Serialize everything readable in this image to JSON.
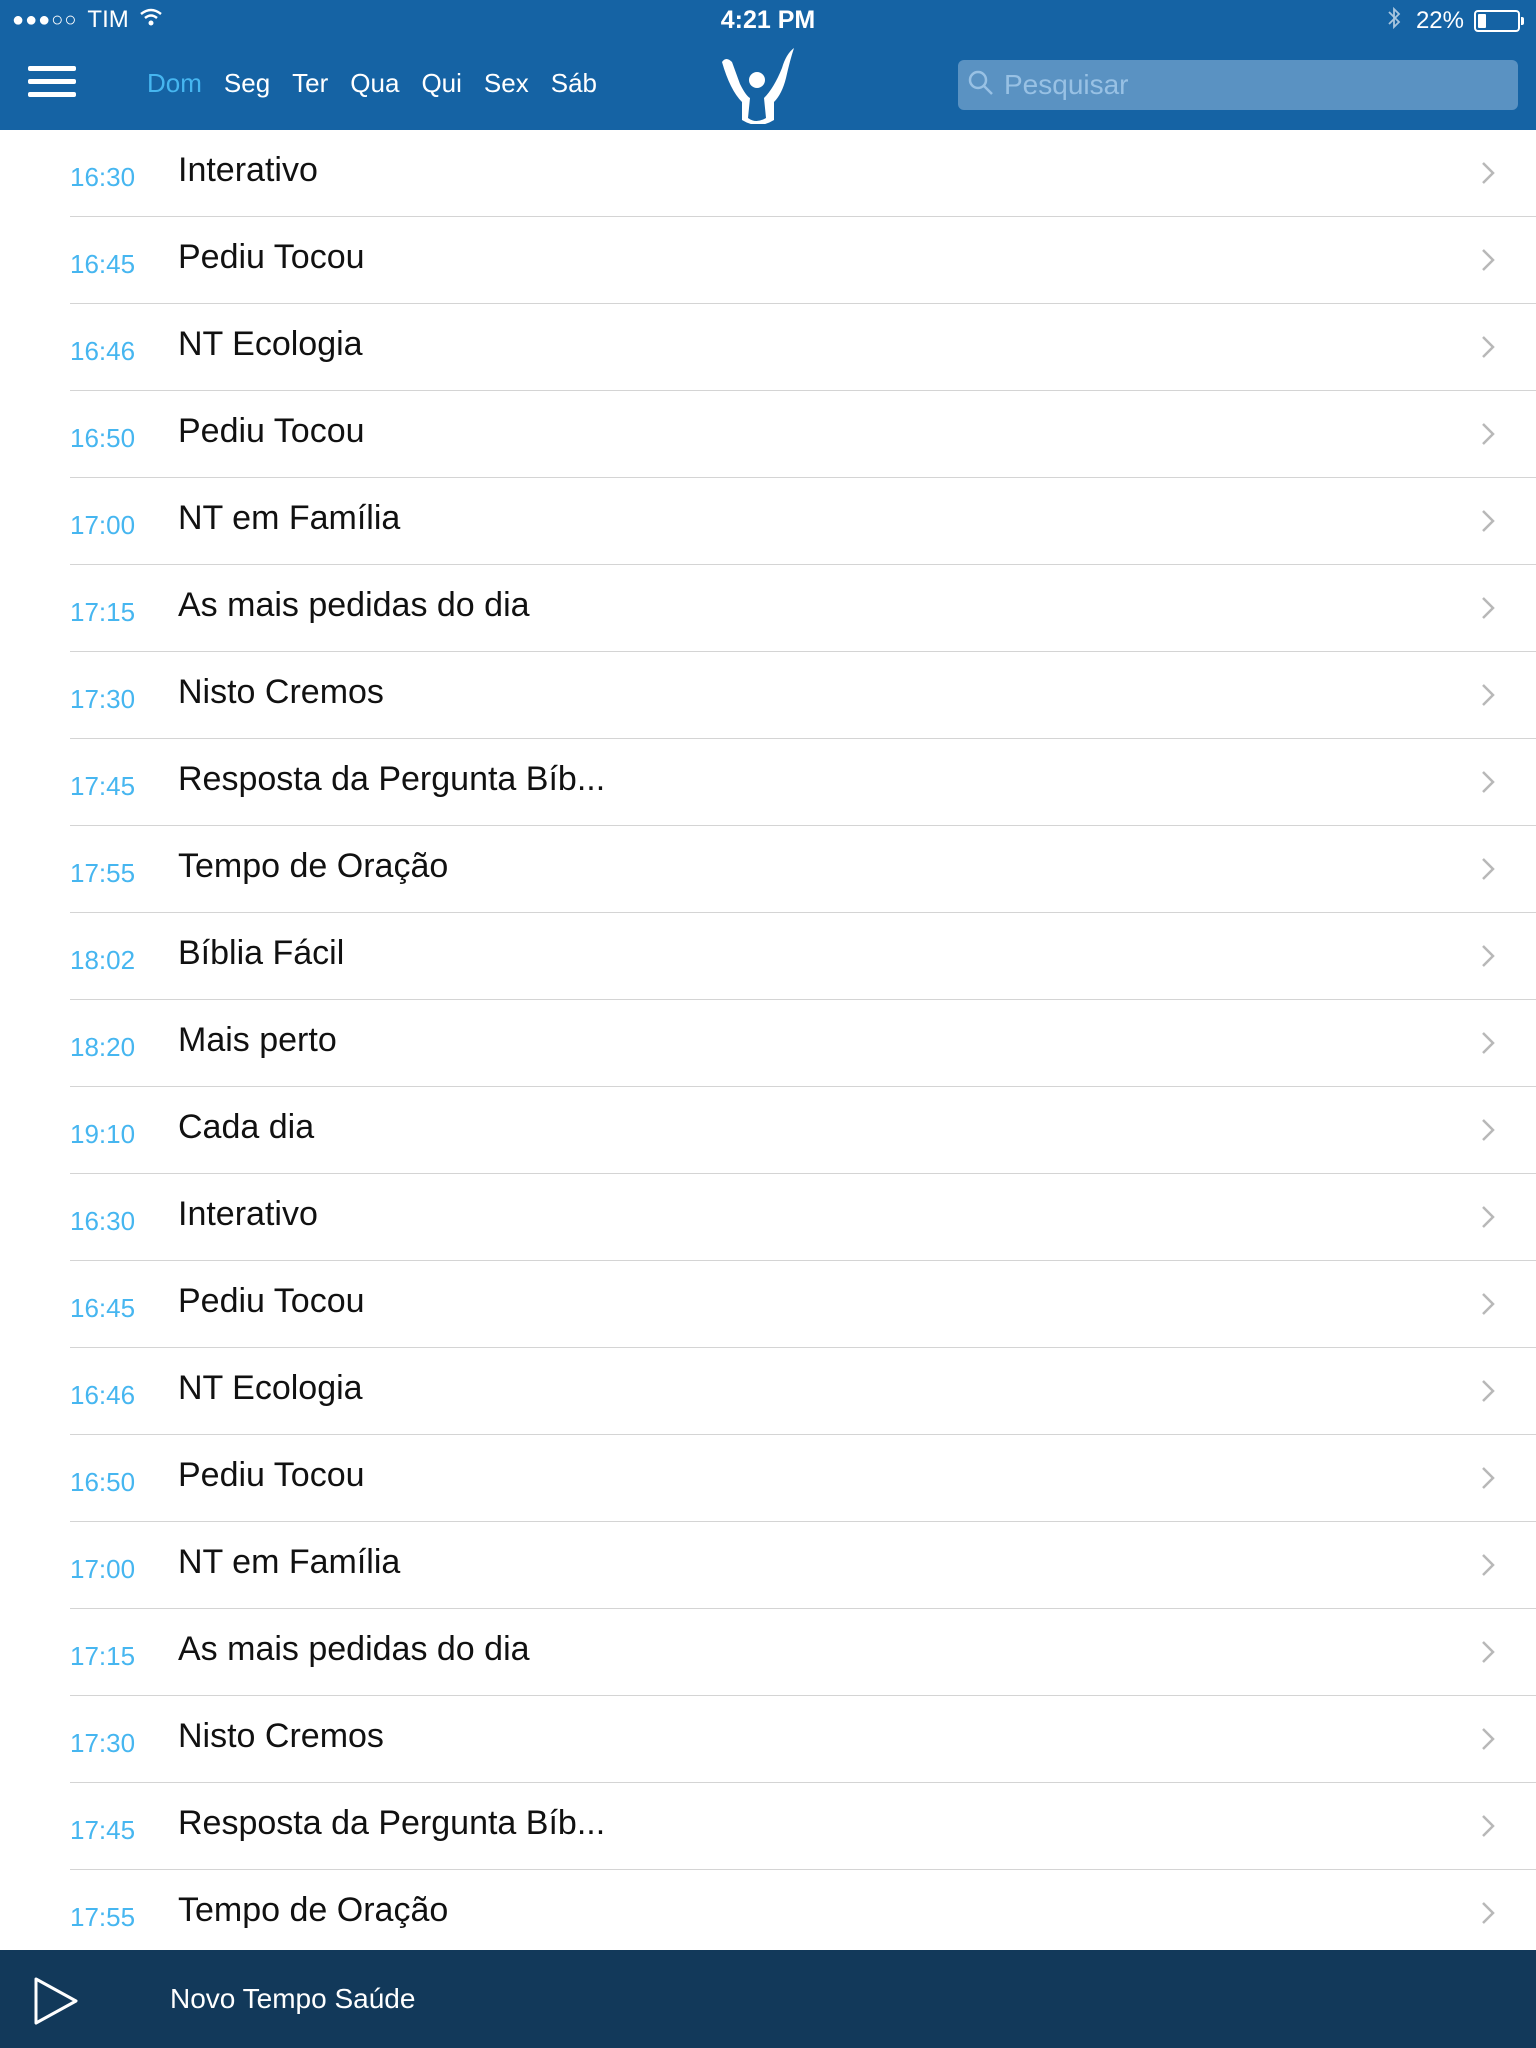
{
  "status_bar": {
    "signal": "●●●○○",
    "carrier": "TIM",
    "time": "4:21 PM",
    "battery": "22%"
  },
  "nav": {
    "days": [
      {
        "label": "Dom",
        "active": true
      },
      {
        "label": "Seg",
        "active": false
      },
      {
        "label": "Ter",
        "active": false
      },
      {
        "label": "Qua",
        "active": false
      },
      {
        "label": "Qui",
        "active": false
      },
      {
        "label": "Sex",
        "active": false
      },
      {
        "label": "Sáb",
        "active": false
      }
    ]
  },
  "search": {
    "placeholder": "Pesquisar"
  },
  "schedule": [
    {
      "time": "16:30",
      "title": "Interativo"
    },
    {
      "time": "16:45",
      "title": "Pediu Tocou"
    },
    {
      "time": "16:46",
      "title": "NT Ecologia"
    },
    {
      "time": "16:50",
      "title": "Pediu Tocou"
    },
    {
      "time": "17:00",
      "title": "NT em Família"
    },
    {
      "time": "17:15",
      "title": "As mais pedidas do dia"
    },
    {
      "time": "17:30",
      "title": "Nisto Cremos"
    },
    {
      "time": "17:45",
      "title": "Resposta da Pergunta Bíb..."
    },
    {
      "time": "17:55",
      "title": "Tempo de Oração"
    },
    {
      "time": "18:02",
      "title": "Bíblia Fácil"
    },
    {
      "time": "18:20",
      "title": "Mais perto"
    },
    {
      "time": "19:10",
      "title": "Cada dia"
    },
    {
      "time": "16:30",
      "title": "Interativo"
    },
    {
      "time": "16:45",
      "title": "Pediu Tocou"
    },
    {
      "time": "16:46",
      "title": "NT Ecologia"
    },
    {
      "time": "16:50",
      "title": "Pediu Tocou"
    },
    {
      "time": "17:00",
      "title": "NT em Família"
    },
    {
      "time": "17:15",
      "title": "As mais pedidas do dia"
    },
    {
      "time": "17:30",
      "title": "Nisto Cremos"
    },
    {
      "time": "17:45",
      "title": "Resposta da Pergunta Bíb..."
    },
    {
      "time": "17:55",
      "title": "Tempo de Oração"
    }
  ],
  "player": {
    "now_playing": "Novo Tempo Saúde"
  },
  "colors": {
    "header_bg": "#1563a4",
    "accent": "#46b6f0",
    "player_bg": "#12395a"
  },
  "icons": [
    "menu-icon",
    "wifi-icon",
    "bluetooth-icon",
    "battery-icon",
    "logo-icon",
    "search-icon",
    "chevron-right-icon",
    "play-icon"
  ]
}
